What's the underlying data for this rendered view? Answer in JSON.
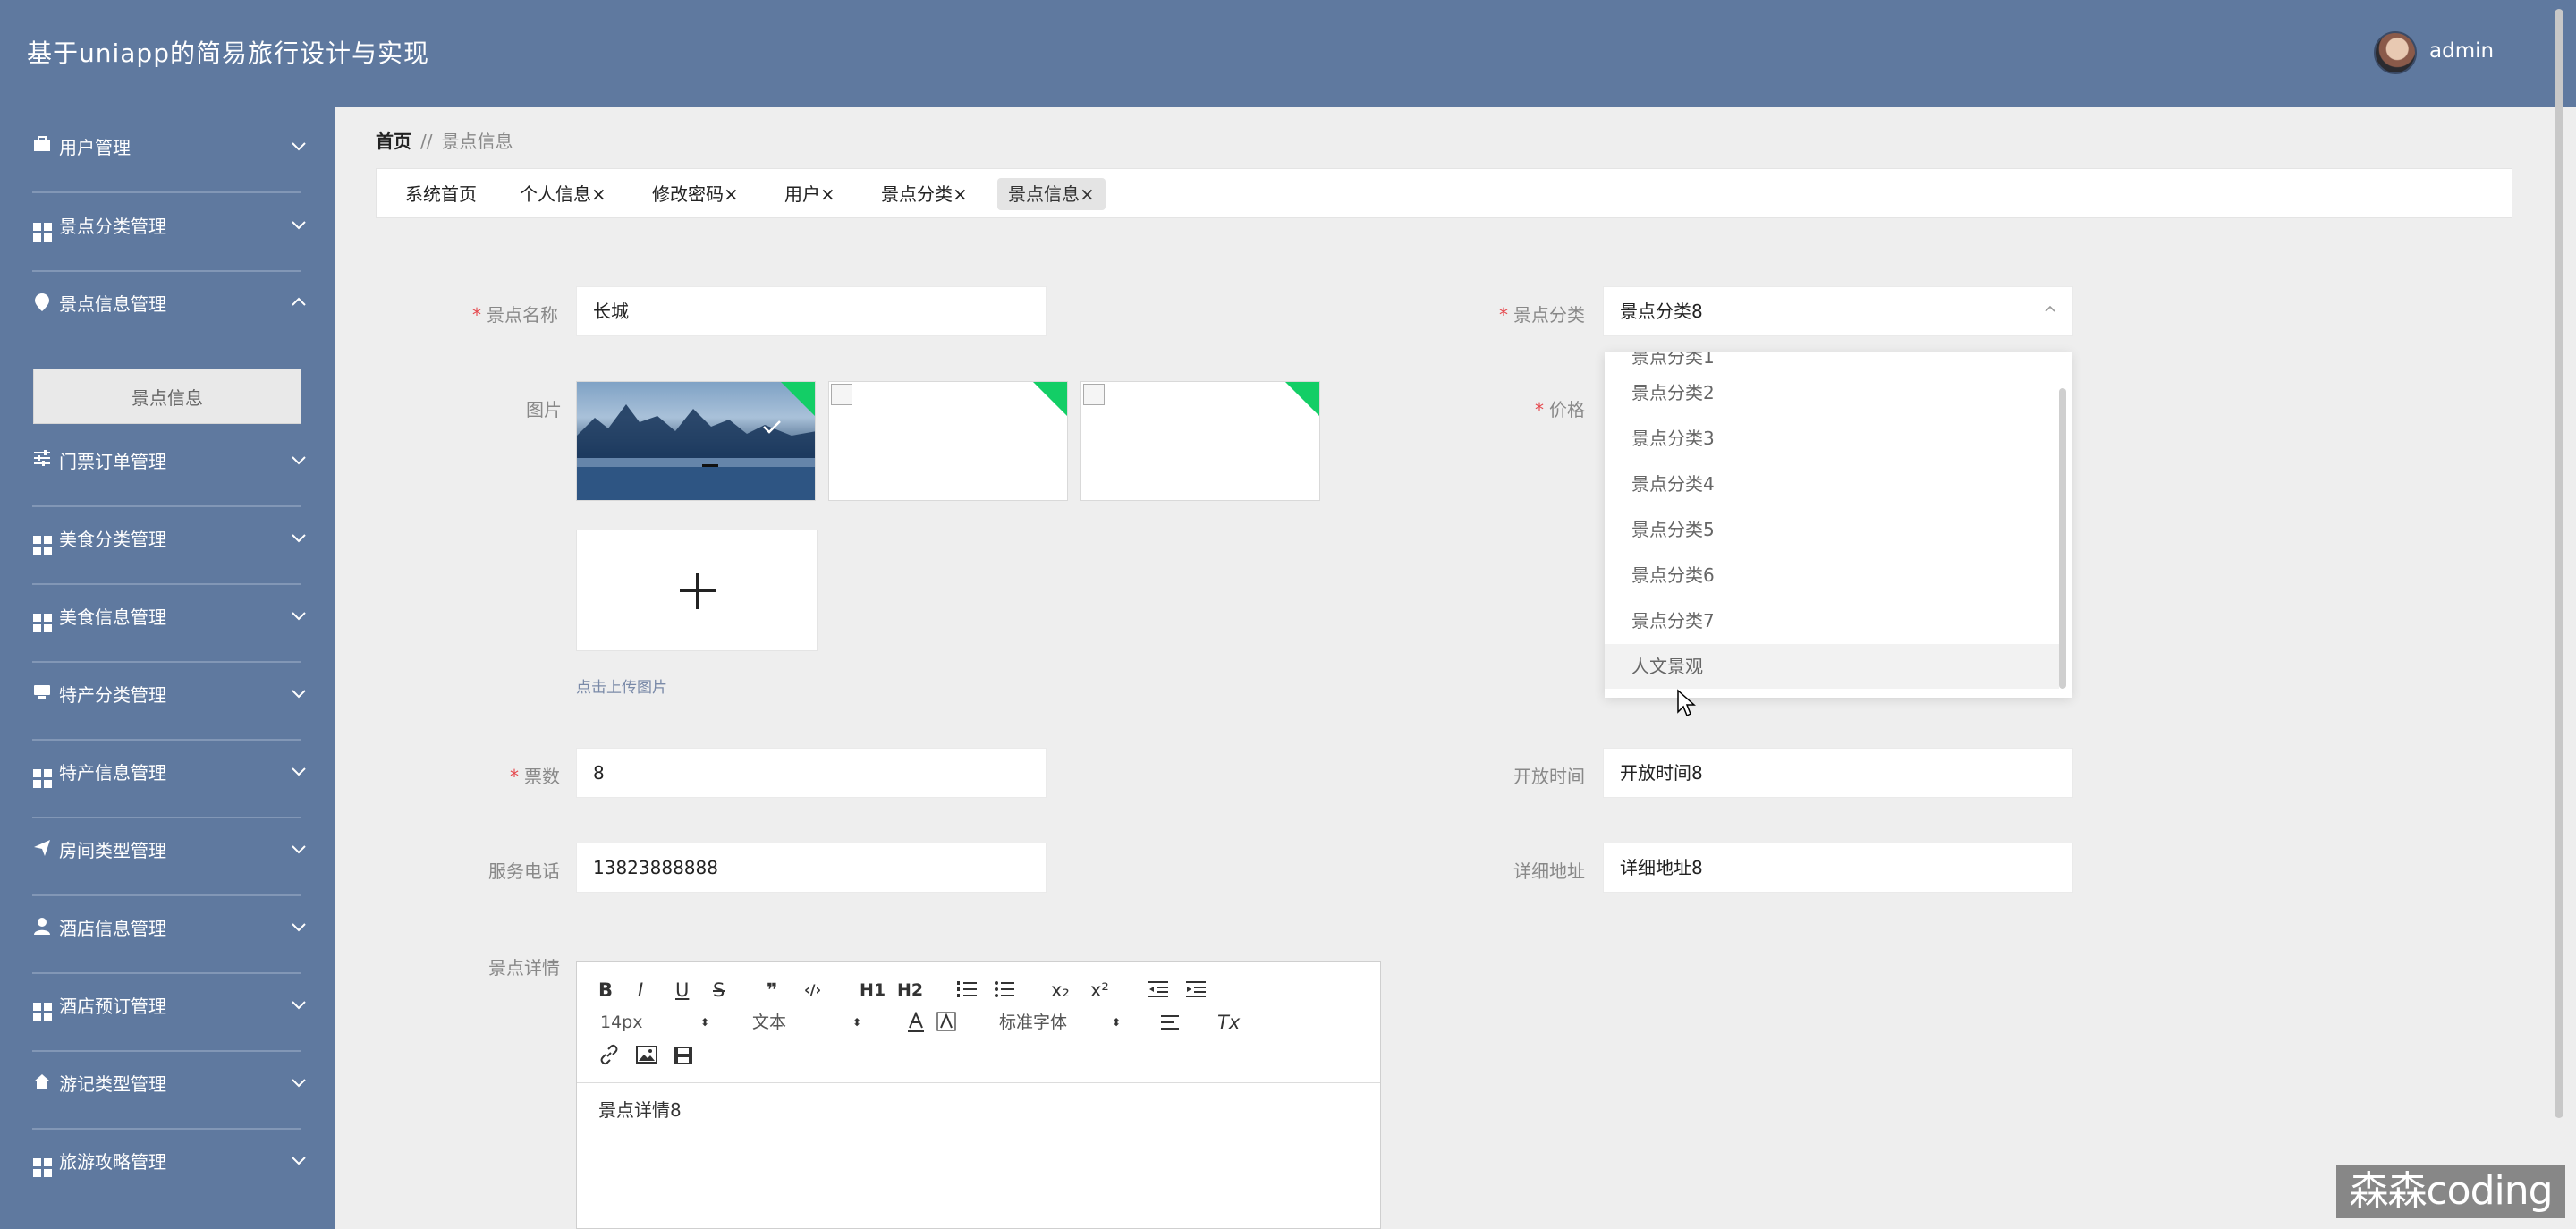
{
  "header": {
    "app_title": "基于uniapp的简易旅行设计与实现",
    "user_name": "admin"
  },
  "sidebar": {
    "items": [
      {
        "label": "用户管理",
        "icon": "briefcase-icon"
      },
      {
        "label": "景点分类管理",
        "icon": "grid-icon"
      },
      {
        "label": "景点信息管理",
        "icon": "location-pin-icon",
        "expanded": true
      },
      {
        "label": "门票订单管理",
        "icon": "sliders-icon"
      },
      {
        "label": "美食分类管理",
        "icon": "grid-icon"
      },
      {
        "label": "美食信息管理",
        "icon": "grid-icon"
      },
      {
        "label": "特产分类管理",
        "icon": "monitor-icon"
      },
      {
        "label": "特产信息管理",
        "icon": "grid-icon"
      },
      {
        "label": "房间类型管理",
        "icon": "send-icon"
      },
      {
        "label": "酒店信息管理",
        "icon": "user-icon"
      },
      {
        "label": "酒店预订管理",
        "icon": "grid-icon"
      },
      {
        "label": "游记类型管理",
        "icon": "home-icon"
      },
      {
        "label": "旅游攻略管理",
        "icon": "grid-icon"
      }
    ],
    "submenu_label": "景点信息"
  },
  "breadcrumb": {
    "home": "首页",
    "separator": "//",
    "current": "景点信息"
  },
  "tabs": [
    {
      "label": "系统首页"
    },
    {
      "label": "个人信息",
      "close": "×"
    },
    {
      "label": "修改密码",
      "close": "×"
    },
    {
      "label": "用户",
      "close": "×"
    },
    {
      "label": "景点分类",
      "close": "×"
    },
    {
      "label": "景点信息",
      "close": "×",
      "active": true
    }
  ],
  "form": {
    "name_label": "景点名称",
    "name_value": "长城",
    "category_label": "景点分类",
    "category_value": "景点分类8",
    "image_label": "图片",
    "upload_hint": "点击上传图片",
    "price_label": "价格",
    "tickets_label": "票数",
    "tickets_value": "8",
    "open_time_label": "开放时间",
    "open_time_value": "开放时间8",
    "phone_label": "服务电话",
    "phone_value": "13823888888",
    "address_label": "详细地址",
    "address_value": "详细地址8",
    "detail_label": "景点详情",
    "required_mark": "*"
  },
  "dropdown": {
    "options": [
      "景点分类2",
      "景点分类3",
      "景点分类4",
      "景点分类5",
      "景点分类6",
      "景点分类7",
      "人文景观"
    ],
    "hovered": "人文景观"
  },
  "editor": {
    "font_size": "14px",
    "text_type": "文本",
    "font_family": "标准字体",
    "content": "景点详情8",
    "buttons": {
      "bold": "B",
      "italic": "I",
      "underline": "U",
      "strike": "S",
      "quote": "❞",
      "code": "‹/›",
      "h1": "H1",
      "h2": "H2",
      "sub": "x₂",
      "sup": "x²",
      "clear": "Tx"
    }
  },
  "watermark": "森森coding",
  "colors": {
    "sidebar_bg": "#5f799f",
    "required": "#e5484d",
    "upload_corner": "#13ce66"
  }
}
